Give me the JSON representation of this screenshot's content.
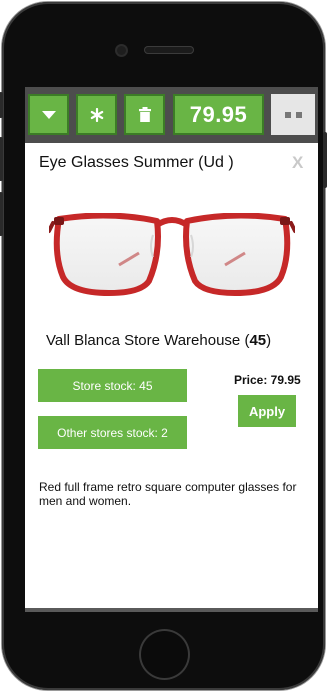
{
  "toolbar": {
    "price": "79.95",
    "icons": [
      "chevron-down-icon",
      "asterisk-icon",
      "trash-icon",
      "view-mode-icon"
    ],
    "button_color": "#69b545"
  },
  "product": {
    "title": "Eye Glasses Summer (Ud )",
    "close_label": "X",
    "frame_color": "#c62828",
    "store_name": "Vall Blanca Store Warehouse",
    "store_count": "45",
    "store_stock_label": "Store stock: 45",
    "other_stock_label": "Other stores stock: 2",
    "price_label": "Price: 79.95",
    "apply_label": "Apply",
    "description": "Red full frame retro square computer glasses for men and women."
  }
}
